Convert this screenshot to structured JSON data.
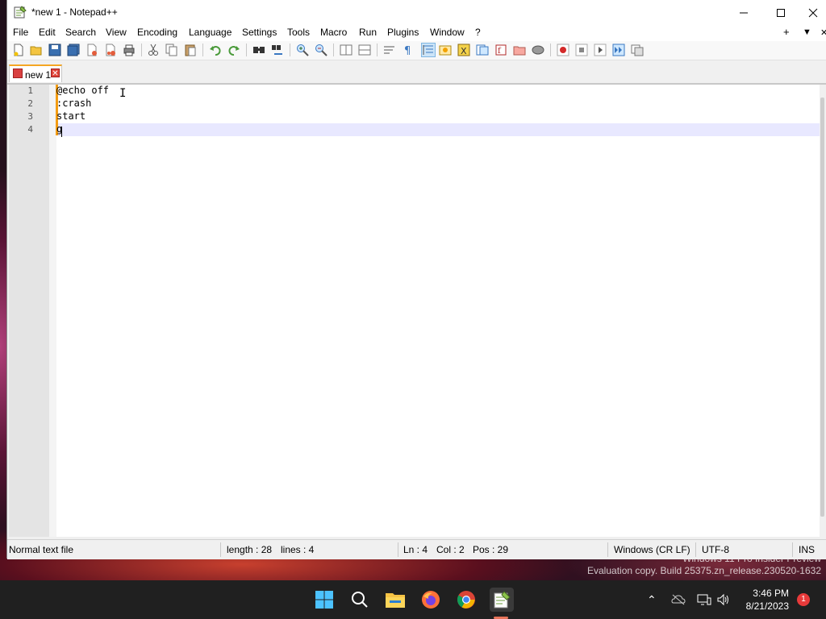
{
  "window": {
    "title": "*new 1 - Notepad++",
    "minimize_icon": "minimize-icon",
    "maximize_icon": "maximize-icon",
    "close_icon": "close-icon"
  },
  "menu": {
    "items": [
      "File",
      "Edit",
      "Search",
      "View",
      "Encoding",
      "Language",
      "Settings",
      "Tools",
      "Macro",
      "Run",
      "Plugins",
      "Window",
      "?"
    ],
    "right": [
      "+",
      "▼",
      "✕"
    ]
  },
  "toolbar": {
    "icons": [
      "new-file-icon",
      "open-file-icon",
      "save-icon",
      "save-all-icon",
      "close-icon",
      "close-all-icon",
      "print-icon",
      "cut-icon",
      "copy-icon",
      "paste-icon",
      "undo-icon",
      "redo-icon",
      "find-icon",
      "replace-icon",
      "zoom-in-icon",
      "zoom-out-icon",
      "sync-vertical-icon",
      "sync-horizontal-icon",
      "word-wrap-icon",
      "show-all-chars-icon",
      "indent-guide-icon",
      "user-defined-lang-icon",
      "doc-map-icon",
      "doc-list-icon",
      "function-list-icon",
      "folder-workspace-icon",
      "monitoring-icon",
      "record-macro-icon",
      "stop-record-icon",
      "playback-macro-icon",
      "run-macro-multiple-icon",
      "save-macro-icon"
    ]
  },
  "tab": {
    "label": "new 1"
  },
  "editor": {
    "line_numbers": [
      "1",
      "2",
      "3",
      "4"
    ],
    "lines": [
      "@echo off",
      ":crash",
      "start",
      "g"
    ],
    "mouse_cursor": "I"
  },
  "status": {
    "file_type": "Normal text file",
    "length": "length : 28",
    "lines": "lines : 4",
    "ln": "Ln : 4",
    "col": "Col : 2",
    "pos": "Pos : 29",
    "eol": "Windows (CR LF)",
    "encoding": "UTF-8",
    "mode": "INS"
  },
  "desktop": {
    "watermark_line1": "Windows 11 Pro Insider Preview",
    "watermark_line2": "Evaluation copy. Build 25375.zn_release.230520-1632"
  },
  "taskbar": {
    "apps": [
      "start-icon",
      "search-icon",
      "file-explorer-icon",
      "firefox-icon",
      "chrome-icon",
      "notepad-plus-plus-icon"
    ],
    "time": "3:46 PM",
    "date": "8/21/2023",
    "notification_count": "1"
  },
  "colors": {
    "accent_tab": "#f5a623",
    "caret_line": "#e8e8ff",
    "changed_marker": "#f39c12",
    "taskbar": "#202020"
  }
}
